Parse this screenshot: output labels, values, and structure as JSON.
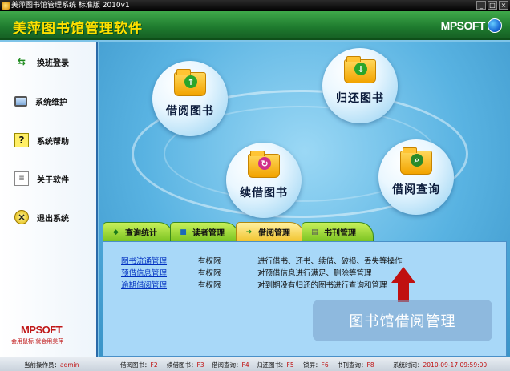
{
  "window": {
    "title": "美萍图书馆管理系统 标准版  2010v1",
    "controls": [
      "_",
      "□",
      "×"
    ]
  },
  "header": {
    "app_title": "美萍图书馆管理软件",
    "logo_text": "MPSOFT"
  },
  "sidebar": {
    "items": [
      {
        "label": "换班登录",
        "icon": "switch-user-icon"
      },
      {
        "label": "系统维护",
        "icon": "monitor-icon"
      },
      {
        "label": "系统帮助",
        "icon": "help-icon"
      },
      {
        "label": "关于软件",
        "icon": "document-icon"
      },
      {
        "label": "退出系统",
        "icon": "exit-icon"
      }
    ],
    "brand": "MPSOFT",
    "brand_sub": "会用鼠标   就会用美萍"
  },
  "modules": [
    {
      "label": "借阅图书",
      "icon": "folder-up-arrow-icon",
      "badge": "↑",
      "badge_color": "#2aa52a"
    },
    {
      "label": "归还图书",
      "icon": "folder-down-arrow-icon",
      "badge": "↓",
      "badge_color": "#2aa52a"
    },
    {
      "label": "续借图书",
      "icon": "folder-renew-icon",
      "badge": "↻",
      "badge_color": "#d0308a"
    },
    {
      "label": "借阅查询",
      "icon": "folder-search-icon",
      "badge": "⌕",
      "badge_color": "#2a8a2a"
    }
  ],
  "tabs": [
    {
      "label": "查询统计",
      "active": false
    },
    {
      "label": "读者管理",
      "active": false
    },
    {
      "label": "借阅管理",
      "active": true
    },
    {
      "label": "书刊管理",
      "active": false
    }
  ],
  "panel": {
    "rows": [
      {
        "name": "图书流通管理",
        "permission": "有权限",
        "description": "进行借书、还书、续借、破损、丢失等操作"
      },
      {
        "name": "预借信息管理",
        "permission": "有权限",
        "description": "对预借信息进行满足、删除等管理"
      },
      {
        "name": "逾期借阅管理",
        "permission": "有权限",
        "description": "对到期没有归还的图书进行查询和管理"
      }
    ],
    "callout": "图书馆借阅管理"
  },
  "status": {
    "operator_label": "当前操作员：",
    "operator": "admin",
    "shortcuts": [
      {
        "label": "借阅图书：",
        "key": "F2"
      },
      {
        "label": "续借图书：",
        "key": "F3"
      },
      {
        "label": "借阅查询：",
        "key": "F4"
      },
      {
        "label": "归还图书：",
        "key": "F5"
      },
      {
        "label": "锁屏：",
        "key": "F6"
      },
      {
        "label": "书刊查询：",
        "key": "F8"
      }
    ],
    "time_label": "系统时间：",
    "time": "2010-09-17  09:59:00"
  },
  "colors": {
    "header_green": "#1e7a2e",
    "title_yellow": "#ffe000",
    "accent_red": "#c01010",
    "link_blue": "#0030c0"
  }
}
